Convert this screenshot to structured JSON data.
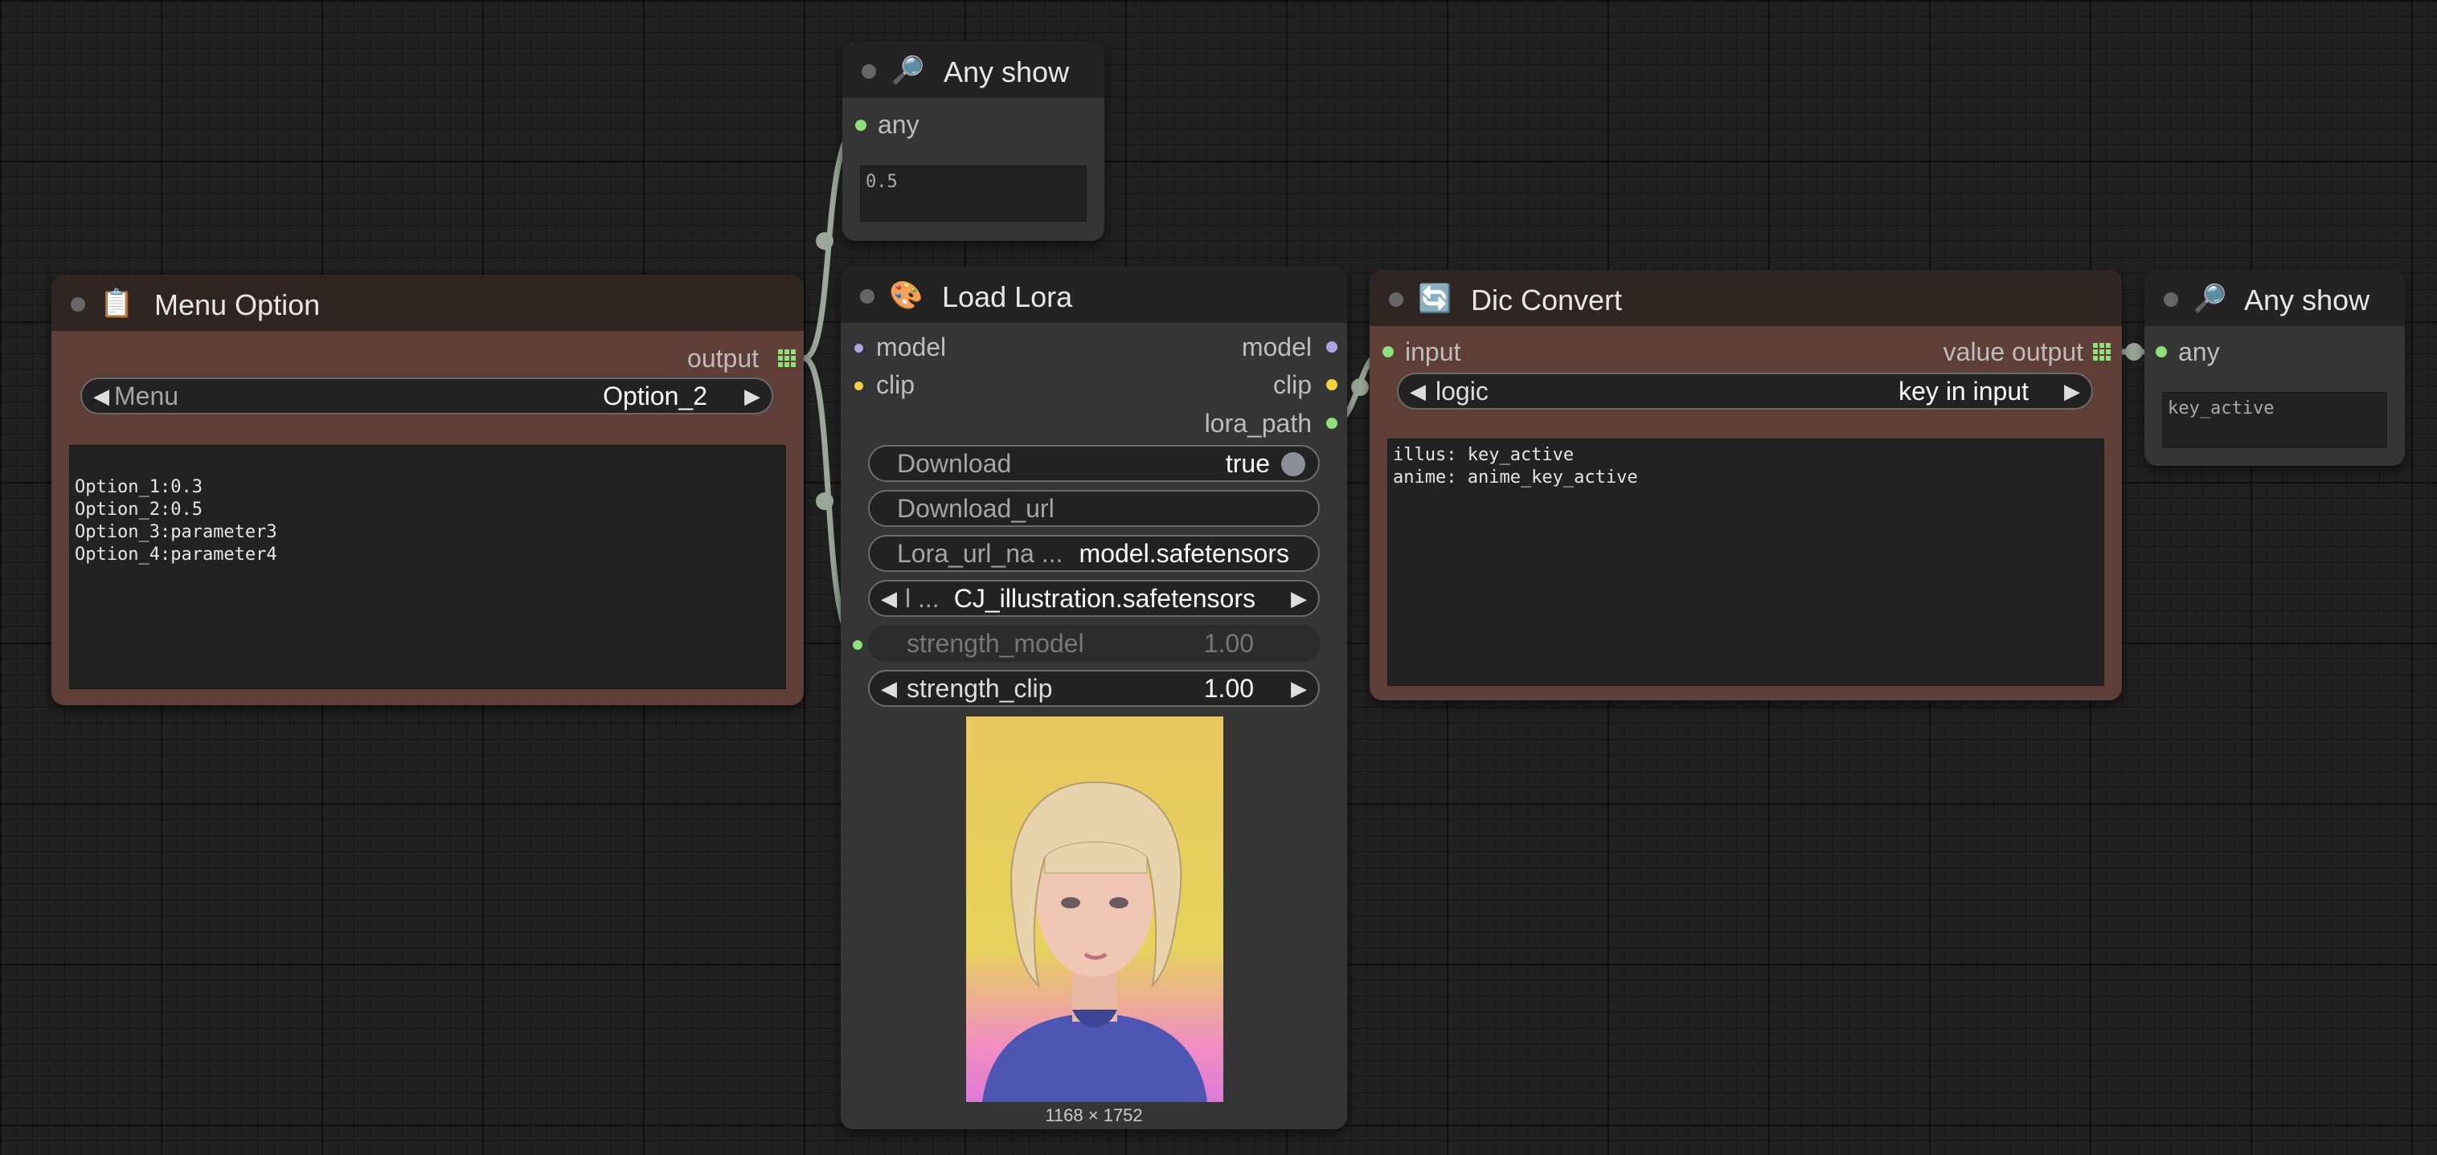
{
  "nodes": {
    "any_show_1": {
      "title": "Any show",
      "icon": "magnifier-icon",
      "input_label": "any",
      "value": "0.5"
    },
    "menu_option": {
      "title": "Menu Option",
      "icon": "clipboard-icon",
      "output_label": "output",
      "menu_label": "Menu",
      "menu_value": "Option_2",
      "text": "Option_1:0.3\nOption_2:0.5\nOption_3:parameter3\nOption_4:parameter4"
    },
    "load_lora": {
      "title": "Load Lora",
      "icon": "palette-icon",
      "inputs": [
        "model",
        "clip"
      ],
      "outputs": [
        "model",
        "clip",
        "lora_path"
      ],
      "download_label": "Download",
      "download_value": "true",
      "download_url_label": "Download_url",
      "lora_url_name_label": "Lora_url_na ...",
      "lora_url_name_value": "model.safetensors",
      "lora_name_label": "l ...",
      "lora_name_value": "CJ_illustration.safetensors",
      "strength_model_label": "strength_model",
      "strength_model_value": "1.00",
      "strength_clip_label": "strength_clip",
      "strength_clip_value": "1.00",
      "image_size": "1168 × 1752"
    },
    "dic_convert": {
      "title": "Dic Convert",
      "icon": "refresh-icon",
      "input_label": "input",
      "output_label": "value output",
      "logic_label": "logic",
      "logic_value": "key in input",
      "text": "illus: key_active\nanime: anime_key_active"
    },
    "any_show_2": {
      "title": "Any show",
      "icon": "magnifier-icon",
      "input_label": "any",
      "value": "key_active"
    }
  },
  "colors": {
    "canvas": "#202020",
    "node_gray": "#353535",
    "node_brown": "#5f3e37",
    "slot_green": "#8ee07a",
    "slot_purple": "#a9a6e3",
    "slot_yellow": "#f5d03b",
    "link": "#9aa89a"
  }
}
